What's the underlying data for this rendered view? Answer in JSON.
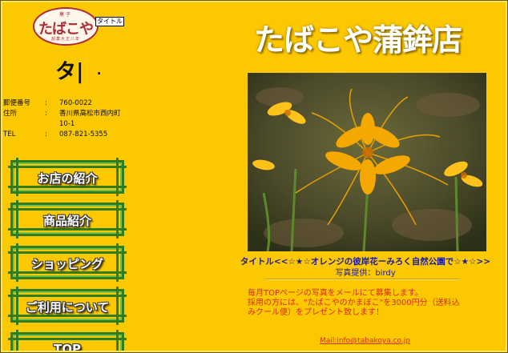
{
  "logo": {
    "top_text": "菓子",
    "main_text": "たばこや",
    "bottom_text": "創業大正八年",
    "badge": "タイトル"
  },
  "shop_kanji": "タ|",
  "shop_dot": ".",
  "address": {
    "postal_label": "郵便番号",
    "postal_value": "760-0022",
    "addr_label": "住所",
    "addr_line1": "香川県高松市西内町",
    "addr_line2": "10-1",
    "tel_label": "TEL",
    "tel_value": "087-821-5355",
    "sep": ":"
  },
  "nav": [
    {
      "label": "お店の紹介"
    },
    {
      "label": "商品紹介"
    },
    {
      "label": "ショッピング"
    },
    {
      "label": "ご利用について"
    },
    {
      "label": "TOP"
    }
  ],
  "title": "たばこや蒲鉾店",
  "photo": {
    "caption": "タイトル<<☆★☆オレンジの彼岸花ーみろく自然公園で☆★☆>>",
    "credit": "写真提供：birdy"
  },
  "notice": {
    "line1": "毎月TOPページの写真をメールにて募集します。",
    "line2": "採用の方には、\"たばこやのかまぼこ\"を3000円分（送料込",
    "line3": "みクール便）をプレゼント致します！"
  },
  "mail": "Mail:info@tabakoya.co.jp",
  "colors": {
    "background": "#fcc800",
    "nav_border": "#2f7d1e",
    "accent_text": "#d92a1a",
    "caption_text": "#1a1aa0"
  }
}
